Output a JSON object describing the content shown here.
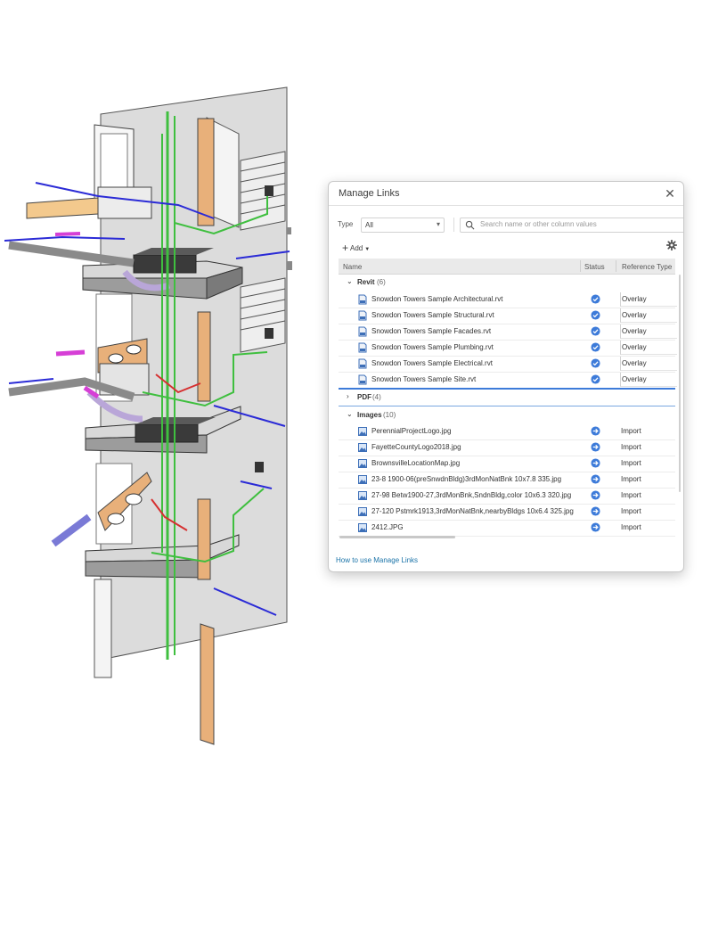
{
  "dialog": {
    "title": "Manage Links",
    "close_icon": "close-icon",
    "type_label": "Type",
    "type_value": "All",
    "search_placeholder": "Search name or other column values",
    "add_label": "Add",
    "settings_icon": "gear-icon",
    "help_link": "How to use Manage Links"
  },
  "table": {
    "columns": {
      "name": "Name",
      "status": "Status",
      "reference_type": "Reference Type"
    },
    "groups": [
      {
        "name": "Revit",
        "count": "(6)",
        "expanded": true,
        "file_icon": "revit-file-icon",
        "items": [
          {
            "name": "Snowdon Towers Sample Architectural.rvt",
            "status": "linked",
            "reference_type": "Overlay"
          },
          {
            "name": "Snowdon Towers Sample Structural.rvt",
            "status": "linked",
            "reference_type": "Overlay"
          },
          {
            "name": "Snowdon Towers Sample Facades.rvt",
            "status": "linked",
            "reference_type": "Overlay"
          },
          {
            "name": "Snowdon Towers Sample Plumbing.rvt",
            "status": "linked",
            "reference_type": "Overlay"
          },
          {
            "name": "Snowdon Towers Sample Electrical.rvt",
            "status": "linked",
            "reference_type": "Overlay"
          },
          {
            "name": "Snowdon Towers Sample Site.rvt",
            "status": "linked",
            "reference_type": "Overlay"
          }
        ]
      },
      {
        "name": "PDF",
        "count": "(4)",
        "expanded": false,
        "items": []
      },
      {
        "name": "Images",
        "count": "(10)",
        "expanded": true,
        "file_icon": "image-file-icon",
        "items": [
          {
            "name": "PerennialProjectLogo.jpg",
            "status": "imported",
            "reference_type": "Import"
          },
          {
            "name": "FayetteCountyLogo2018.jpg",
            "status": "imported",
            "reference_type": "Import"
          },
          {
            "name": "BrownsvilleLocationMap.jpg",
            "status": "imported",
            "reference_type": "Import"
          },
          {
            "name": "23-8 1900-06(preSnwdnBldg)3rdMonNatBnk 10x7.8 335.jpg",
            "status": "imported",
            "reference_type": "Import"
          },
          {
            "name": "27-98 Betw1900-27,3rdMonBnk,SndnBldg,color 10x6.3 320.jpg",
            "status": "imported",
            "reference_type": "Import"
          },
          {
            "name": "27-120 Pstmrk1913,3rdMonNatBnk,nearbyBldgs 10x6.4 325.jpg",
            "status": "imported",
            "reference_type": "Import"
          },
          {
            "name": "2412.JPG",
            "status": "imported",
            "reference_type": "Import"
          }
        ]
      }
    ]
  },
  "colors": {
    "accent": "#3d7bd9",
    "link": "#1a73a8",
    "pipe_blue": "#2b2bd6",
    "pipe_green": "#3fbf3f",
    "pipe_magenta": "#d63fd6",
    "wood": "#e8b07a",
    "duct": "#3a3a3a"
  }
}
